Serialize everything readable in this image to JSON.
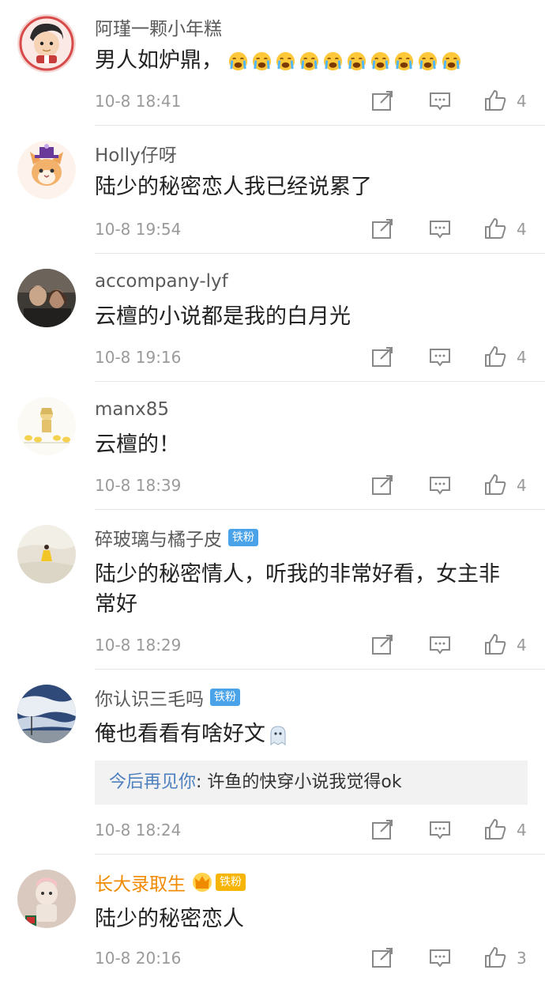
{
  "comments": [
    {
      "user": "阿瑾一颗小年糕",
      "text": "男人如炉鼎，",
      "time": "10-8 18:41",
      "likes": "4",
      "avatar_icon": "cartoon-boy-avatar",
      "emoji_icon": "crying-face-icon",
      "emoji_count": 10
    },
    {
      "user": "Holly仔呀",
      "text": "陆少的秘密恋人我已经说累了",
      "time": "10-8 19:54",
      "likes": "4",
      "avatar_icon": "cat-with-hat-avatar"
    },
    {
      "user": "accompany-lyf",
      "text": "云檀的小说都是我的白月光",
      "time": "10-8 19:16",
      "likes": "4",
      "avatar_icon": "movie-still-avatar"
    },
    {
      "user": "manx85",
      "text": "云檀的！",
      "time": "10-8 18:39",
      "likes": "4",
      "avatar_icon": "duck-drawing-avatar"
    },
    {
      "user": "碎玻璃与橘子皮",
      "badge": "铁粉",
      "text": "陆少的秘密情人，听我的非常好看，女主非常好",
      "time": "10-8 18:29",
      "likes": "4",
      "avatar_icon": "beach-girl-avatar"
    },
    {
      "user": "你认识三毛吗",
      "badge": "铁粉",
      "text": "俺也看看有啥好文",
      "time": "10-8 18:24",
      "likes": "4",
      "avatar_icon": "sky-photo-avatar",
      "emoji_icon": "ghost-icon",
      "reply": {
        "name": "今后再见你",
        "text": ": 许鱼的快穿小说我觉得ok"
      }
    },
    {
      "user": "长大录取生",
      "badge": "铁粉",
      "crown": true,
      "text": "陆少的秘密恋人",
      "time": "10-8 20:16",
      "likes": "3",
      "avatar_icon": "figurine-avatar"
    }
  ],
  "actions": {
    "repost_icon": "repost-icon",
    "comment_icon": "comment-icon",
    "like_icon": "thumbs-up-icon"
  },
  "colors": {
    "username": "#5a5a5a",
    "vip_username": "#f28a00",
    "badge": "#4aa3e8",
    "reply_name": "#4d7fbf",
    "meta": "#9a9a9a"
  }
}
